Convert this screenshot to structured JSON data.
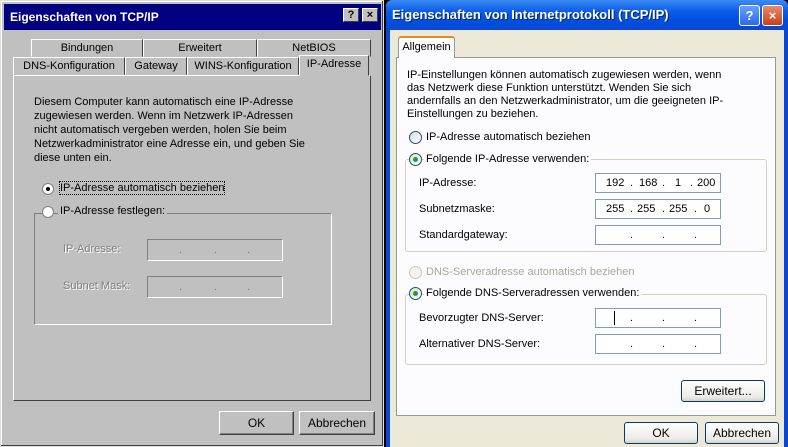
{
  "left": {
    "title": "Eigenschaften von TCP/IP",
    "help_btn": "?",
    "close_btn": "×",
    "tabs_row1": [
      "Bindungen",
      "Erweitert",
      "NetBIOS"
    ],
    "tabs_row2": [
      "DNS-Konfiguration",
      "Gateway",
      "WINS-Konfiguration",
      "IP-Adresse"
    ],
    "description": "Diesem Computer kann automatisch eine IP-Adresse zugewiesen werden. Wenn im Netzwerk IP-Adressen nicht automatisch vergeben werden, holen Sie beim Netzwerkadministrator eine Adresse ein, und geben Sie diese unten ein.",
    "radio_auto": "IP-Adresse automatisch beziehen",
    "radio_manual": "IP-Adresse festlegen:",
    "ip_label": "IP-Adresse:",
    "mask_label": "Subnet Mask:",
    "ok": "OK",
    "cancel": "Abbrechen"
  },
  "right": {
    "title": "Eigenschaften von Internetprotokoll (TCP/IP)",
    "help_btn": "?",
    "close_btn": "×",
    "tab": "Allgemein",
    "description": "IP-Einstellungen können automatisch zugewiesen werden, wenn das Netzwerk diese Funktion unterstützt. Wenden Sie sich andernfalls an den Netzwerkadministrator, um die geeigneten IP-Einstellungen zu beziehen.",
    "radio_ip_auto": "IP-Adresse automatisch beziehen",
    "radio_ip_manual": "Folgende IP-Adresse verwenden:",
    "ip_label": "IP-Adresse:",
    "ip_value": [
      "192",
      "168",
      "1",
      "200"
    ],
    "mask_label": "Subnetzmaske:",
    "mask_value": [
      "255",
      "255",
      "255",
      "0"
    ],
    "gateway_label": "Standardgateway:",
    "radio_dns_auto": "DNS-Serveradresse automatisch beziehen",
    "radio_dns_manual": "Folgende DNS-Serveradressen verwenden:",
    "dns1_label": "Bevorzugter DNS-Server:",
    "dns2_label": "Alternativer DNS-Server:",
    "advanced": "Erweitert...",
    "ok": "OK",
    "cancel": "Abbrechen"
  },
  "colors": {
    "xp_blue": "#0a46d6",
    "w98_title": "#000080",
    "xp_face": "#ece9d8"
  }
}
